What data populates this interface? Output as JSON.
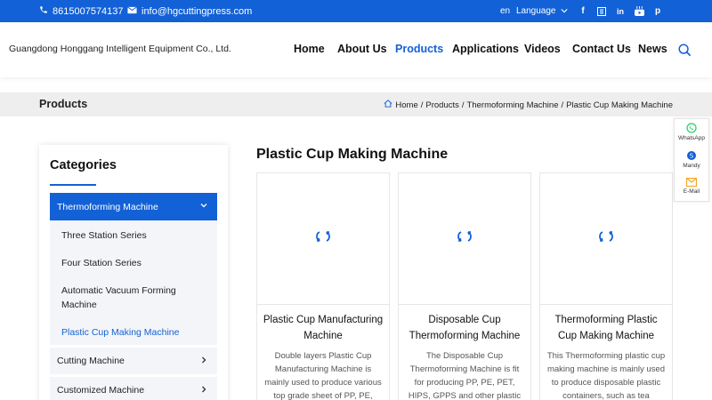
{
  "topbar": {
    "phone": "8615007574137",
    "email": "info@hgcuttingpress.com",
    "lang_code": "en",
    "language_label": "Language",
    "social": [
      {
        "icon": "facebook-icon",
        "glyph": "f"
      },
      {
        "icon": "tumblr-icon",
        "glyph": "t"
      },
      {
        "icon": "linkedin-icon",
        "glyph": "in"
      },
      {
        "icon": "youtube-icon",
        "glyph": "▶"
      },
      {
        "icon": "pinterest-icon",
        "glyph": "p"
      }
    ]
  },
  "header": {
    "company": "Guangdong Honggang Intelligent Equipment Co., Ltd.",
    "nav": [
      "Home",
      "About Us",
      "Products",
      "Applications",
      "Videos",
      "Contact Us",
      "News"
    ],
    "active_nav": "Products"
  },
  "banner": {
    "title": "Products",
    "breadcrumb": [
      "Home",
      "Products",
      "Thermoforming Machine",
      "Plastic Cup Making Machine"
    ],
    "separator": "/"
  },
  "sidebar": {
    "title": "Categories",
    "main_category": "Thermoforming Machine",
    "subcategories": [
      "Three Station Series",
      "Four Station Series",
      "Automatic Vacuum Forming Machine",
      "Plastic Cup Making Machine"
    ],
    "active_sub": "Plastic Cup Making Machine",
    "other_categories": [
      "Cutting Machine",
      "Customized Machine"
    ]
  },
  "main": {
    "title": "Plastic Cup Making Machine",
    "products": [
      {
        "name": "Plastic Cup Manufacturing Machine",
        "desc": "Double layers Plastic Cup Manufacturing Machine is mainly used to produce various top grade sheet of PP, PE,"
      },
      {
        "name": "Disposable Cup Thermoforming Machine",
        "desc": "The Disposable Cup Thermoforming Machine is fit for producing PP, PE, PET, HIPS, GPPS and other plastic"
      },
      {
        "name": "Thermoforming Plastic Cup Making Machine",
        "desc": "This Thermoforming plastic cup making machine is mainly used to produce disposable plastic containers, such as tea"
      }
    ]
  },
  "float_widget": [
    {
      "label": "WhatsApp",
      "icon": "whatsapp-icon"
    },
    {
      "label": "Mandy",
      "icon": "skype-icon"
    },
    {
      "label": "E-Mail",
      "icon": "mail-icon"
    }
  ],
  "colors": {
    "brand": "#1361d6",
    "banner_bg": "#eeeeee",
    "sidebar_sub_bg": "#f3f5f8",
    "whatsapp": "#25d366",
    "mail": "#f5a623"
  }
}
